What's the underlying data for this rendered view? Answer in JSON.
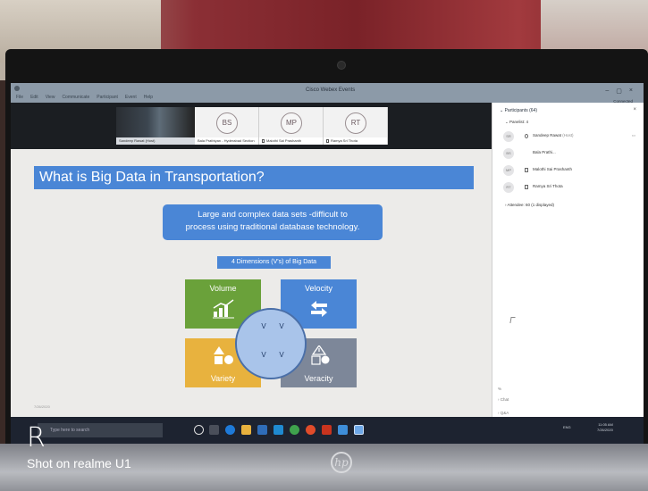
{
  "app": {
    "window_title": "Cisco Webex Events",
    "menu": [
      "File",
      "Edit",
      "View",
      "Communicate",
      "Participant",
      "Event",
      "Help"
    ],
    "connected": "Connected",
    "controls": [
      "–",
      "▢",
      "×"
    ]
  },
  "video_strip": {
    "tiles": [
      {
        "initials": "",
        "name": "Sandeep Rawat (Host)"
      },
      {
        "initials": "BS",
        "name": "Bala Prathiyan - Hyderabad Section"
      },
      {
        "initials": "MP",
        "name": "Malothi Sai Prashanth"
      },
      {
        "initials": "RT",
        "name": "Ramya Sri Thota"
      }
    ]
  },
  "slide": {
    "title": "What is Big Data in Transportation?",
    "definition_line1": "Large and complex data sets -difficult to",
    "definition_line2": "process using traditional database technology.",
    "dimensions_label": "4 Dimensions (V's) of Big Data",
    "quadrants": {
      "volume": "Volume",
      "velocity": "Velocity",
      "variety": "Variety",
      "veracity": "Veracity"
    },
    "v_letter": "V",
    "date": "7/26/2020",
    "colors": {
      "title_bar": "#4a86d6",
      "volume": "#6aa13a",
      "velocity": "#4a86d6",
      "variety": "#e8b23e",
      "veracity": "#7d8799"
    }
  },
  "participants": {
    "header": "Participants (64)",
    "presenter_header": "Panelist: 4",
    "panelists": [
      {
        "initials": "SR",
        "name": "Sandeep Rawat",
        "role": "(Host)"
      },
      {
        "initials": "BS",
        "name": "Bala Prathi...",
        "role": ""
      },
      {
        "initials": "MP",
        "name": "Malothi Sai Prashanth",
        "role": ""
      },
      {
        "initials": "RT",
        "name": "Ramya Sri Thota",
        "role": ""
      }
    ],
    "attendees": "Attendee: 60 (1 displayed)",
    "tabs": [
      "Chat",
      "Q&A"
    ]
  },
  "taskbar": {
    "search_placeholder": "Type here to search",
    "tray": "ENG",
    "time": "11:05 AM",
    "date": "7/26/2020"
  },
  "watermark": {
    "logo": "R",
    "text": "Shot on realme U1"
  },
  "laptop_brand": "hp"
}
